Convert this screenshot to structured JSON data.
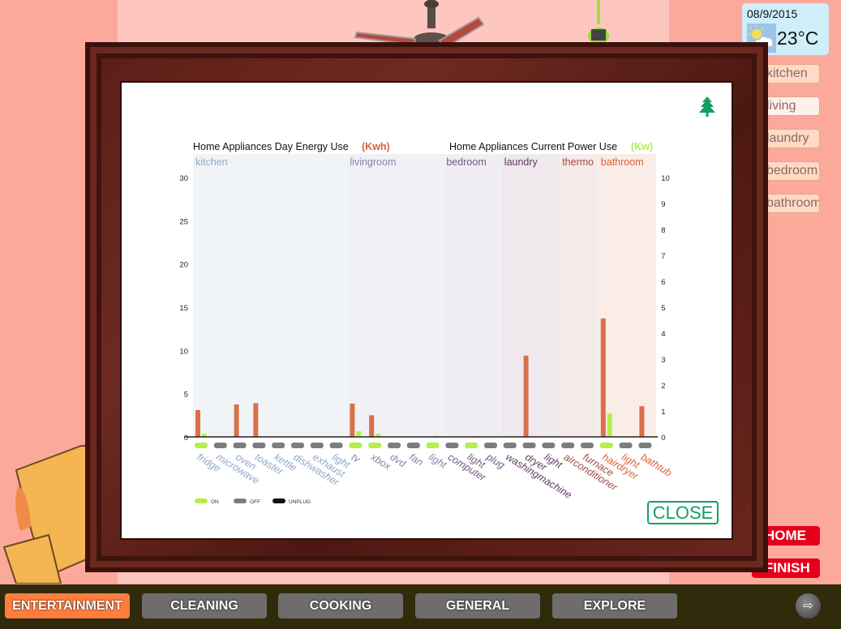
{
  "weather": {
    "date": "08/9/2015",
    "temperature": "23°C",
    "icon": "partly-cloudy-icon"
  },
  "rooms": [
    {
      "label": "kitchen",
      "active": false
    },
    {
      "label": "living",
      "active": true
    },
    {
      "label": "laundry",
      "active": false
    },
    {
      "label": "bedroom",
      "active": false
    },
    {
      "label": "bathroom",
      "active": false
    }
  ],
  "side_buttons": {
    "home": "HOME",
    "finish": "FINISH"
  },
  "modal": {
    "close_label": "CLOSE",
    "icon": "tree-icon"
  },
  "bottom_bar": {
    "tabs": [
      {
        "label": "ENTERTAINMENT",
        "active": true
      },
      {
        "label": "CLEANING",
        "active": false
      },
      {
        "label": "COOKING",
        "active": false
      },
      {
        "label": "GENERAL",
        "active": false
      },
      {
        "label": "EXPLORE",
        "active": false
      }
    ],
    "logout_icon": "logout-icon"
  },
  "colors": {
    "energy_bar": "#d9704a",
    "power_bar": "#b4f04a",
    "on": "#b4f04a",
    "off": "#7d7d7d",
    "unplug": "#111111",
    "close_green": "#12a061"
  },
  "chart_data": {
    "type": "bar",
    "title_left": "Home Appliances Day Energy Use",
    "unit_left": "(Kwh)",
    "title_right": "Home Appliances Current Power Use",
    "unit_right": "(Kw)",
    "ylim_left": [
      0,
      30
    ],
    "yticks_left": [
      0,
      5,
      10,
      15,
      20,
      25,
      30
    ],
    "ylim_right": [
      0,
      10
    ],
    "yticks_right": [
      0,
      1,
      2,
      3,
      4,
      5,
      6,
      7,
      8,
      9,
      10
    ],
    "rooms": [
      {
        "name": "kitchen",
        "color": "#8fa8c4",
        "bg": "#f1f4f7",
        "start": 0,
        "count": 8
      },
      {
        "name": "livingroom",
        "color": "#8a81ae",
        "bg": "#f1f0f4",
        "start": 8,
        "count": 5
      },
      {
        "name": "bedroom",
        "color": "#735988",
        "bg": "#f0eef2",
        "start": 13,
        "count": 3
      },
      {
        "name": "laundry",
        "color": "#5f3a63",
        "bg": "#efe9ee",
        "start": 16,
        "count": 3
      },
      {
        "name": "thermo",
        "color": "#9c4d45",
        "bg": "#f5ebea",
        "start": 19,
        "count": 2
      },
      {
        "name": "bathroom",
        "color": "#d9623a",
        "bg": "#faede7",
        "start": 21,
        "count": 3
      }
    ],
    "categories": [
      "fridge",
      "microwave",
      "oven",
      "toaster",
      "kettle",
      "dishwasher",
      "exhaust",
      "light",
      "tv",
      "xbox",
      "dvd",
      "fan",
      "light",
      "computer",
      "light",
      "plug",
      "washingmachine",
      "dryer",
      "light",
      "airconditioner",
      "furnace",
      "hairdryer",
      "light",
      "bathtub"
    ],
    "series": [
      {
        "name": "Day Energy Use (Kwh)",
        "axis": "left",
        "values": [
          3.1,
          0,
          3.75,
          3.9,
          0,
          0,
          0,
          0,
          3.85,
          2.5,
          0,
          0,
          0,
          0,
          0,
          0,
          0,
          9.4,
          0,
          0,
          0,
          13.7,
          0,
          3.55
        ]
      },
      {
        "name": "Current Power Use (Kw)",
        "axis": "right",
        "values": [
          0.12,
          0,
          0,
          0,
          0,
          0,
          0,
          0,
          0.22,
          0.12,
          0,
          0,
          0.04,
          0,
          0.04,
          0,
          0,
          0,
          0,
          0,
          0,
          0.9,
          0,
          0
        ]
      }
    ],
    "status": [
      "ON",
      "OFF",
      "OFF",
      "OFF",
      "OFF",
      "OFF",
      "OFF",
      "OFF",
      "ON",
      "ON",
      "OFF",
      "OFF",
      "ON",
      "OFF",
      "ON",
      "OFF",
      "OFF",
      "OFF",
      "OFF",
      "OFF",
      "OFF",
      "ON",
      "OFF",
      "OFF"
    ],
    "legend": [
      {
        "label": "ON",
        "color": "#b4f04a"
      },
      {
        "label": "OFF",
        "color": "#7d7d7d"
      },
      {
        "label": "UNPLUG",
        "color": "#111111"
      }
    ],
    "legend_position": "bottom-left"
  }
}
